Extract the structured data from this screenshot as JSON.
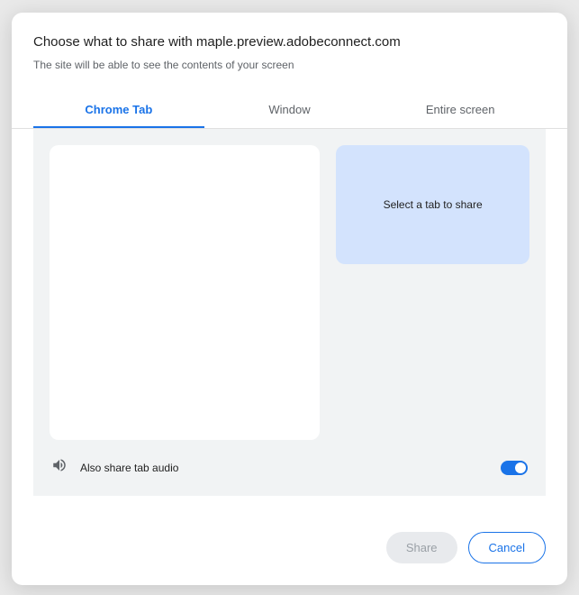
{
  "header": {
    "title": "Choose what to share with maple.preview.adobeconnect.com",
    "subtitle": "The site will be able to see the contents of your screen"
  },
  "tabs": {
    "chrome_tab": "Chrome Tab",
    "window": "Window",
    "entire_screen": "Entire screen"
  },
  "preview": {
    "placeholder": "Select a tab to share"
  },
  "audio": {
    "label": "Also share tab audio"
  },
  "buttons": {
    "share": "Share",
    "cancel": "Cancel"
  }
}
